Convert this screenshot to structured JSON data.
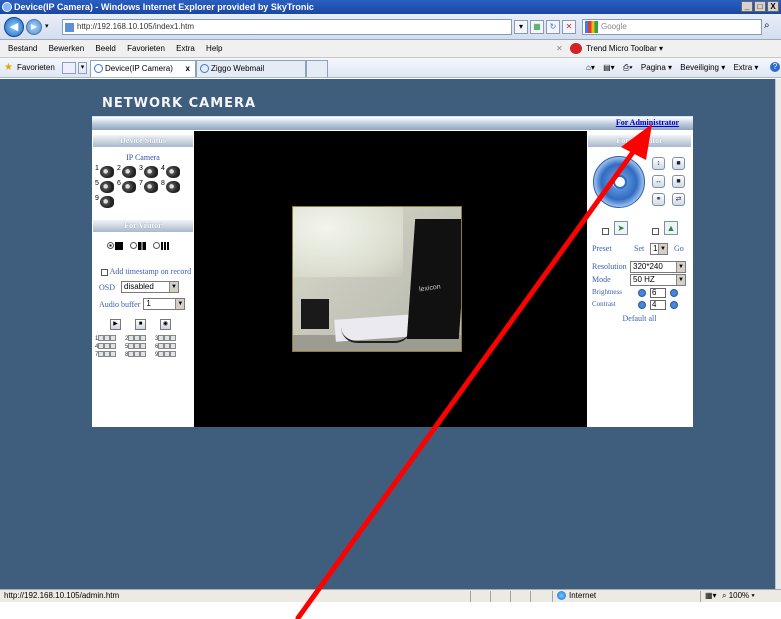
{
  "window": {
    "title": "Device(IP Camera) - Windows Internet Explorer provided by SkyTronic",
    "controls": [
      "_",
      "□",
      "X"
    ]
  },
  "addressbar": {
    "url": "http://192.168.10.105/index1.htm",
    "search_placeholder": "Google"
  },
  "menu": {
    "items": [
      "Bestand",
      "Bewerken",
      "Beeld",
      "Favorieten",
      "Extra",
      "Help"
    ],
    "trend_toolbar": "Trend Micro Toolbar ▾"
  },
  "favorites": {
    "label": "Favorieten",
    "tabs": [
      {
        "label": "Device(IP Camera)",
        "active": true
      },
      {
        "label": "Ziggo Webmail",
        "active": false
      }
    ],
    "commands": [
      "Pagina ▾",
      "Beveiliging ▾",
      "Extra ▾"
    ]
  },
  "page": {
    "logo": "NETWORK CAMERA",
    "admin_link": "For Administrator",
    "left": {
      "device_status_title": "Device Status",
      "device_name": "IP Camera",
      "cameras": [
        "1",
        "2",
        "3",
        "4",
        "5",
        "6",
        "7",
        "8",
        "9"
      ],
      "visitor_title": "For Visitor",
      "timestamp_label": "Add timestamp on record",
      "osd_label": "OSD",
      "osd_value": "disabled",
      "audio_buffer_label": "Audio buffer",
      "audio_buffer_value": "1",
      "channels": [
        "1",
        "2",
        "3",
        "4",
        "5",
        "6",
        "7",
        "8",
        "9"
      ]
    },
    "right": {
      "operator_title": "For Operator",
      "preset_label": "Preset",
      "set_label": "Set",
      "preset_value": "1",
      "go_label": "Go",
      "resolution_label": "Resolution",
      "resolution_value": "320*240",
      "mode_label": "Mode",
      "mode_value": "50 HZ",
      "brightness_label": "Brightness",
      "brightness_value": "6",
      "contrast_label": "Contrast",
      "contrast_value": "4",
      "default_all": "Default all"
    },
    "feed_text": "lexicon"
  },
  "statusbar": {
    "url": "http://192.168.10.105/admin.htm",
    "zone": "Internet",
    "zoom": "100%"
  },
  "colors": {
    "page_bg": "#3f5d7d",
    "link": "#0000cc",
    "annotation_arrow": "#ff0000"
  }
}
